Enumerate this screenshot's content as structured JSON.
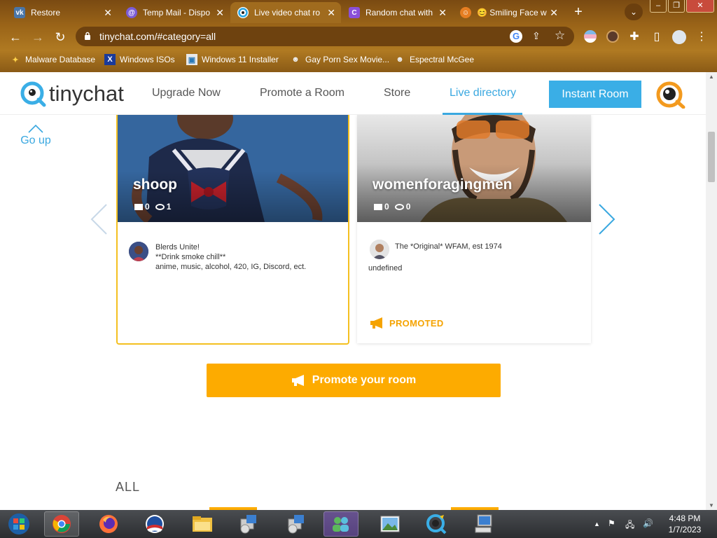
{
  "browser": {
    "tabs": [
      {
        "label": "Restore",
        "icon": "vk-icon",
        "color": "#4a76a8",
        "active": false
      },
      {
        "label": "Temp Mail - Dispo",
        "icon": "temp-mail-icon",
        "color": "#7b5cd6",
        "active": false
      },
      {
        "label": "Live video chat ro",
        "icon": "tinychat-icon",
        "color": "#2aa7e3",
        "active": true
      },
      {
        "label": "Random chat with",
        "icon": "chat-c-icon",
        "color": "#8a4fd8",
        "active": false
      },
      {
        "label": "😊 Smiling Face w",
        "icon": "emoji-icon",
        "color": "#e67e22",
        "active": false
      }
    ],
    "url": "tinychat.com/#category=all",
    "bookmarks": [
      {
        "label": "Malware Database",
        "icon": "mw-icon"
      },
      {
        "label": "Windows ISOs",
        "icon": "x-icon"
      },
      {
        "label": "Windows 11 Installer",
        "icon": "installer-icon"
      },
      {
        "label": "Gay Porn Sex Movie...",
        "icon": "bookmark-icon"
      },
      {
        "label": "Espectral McGee",
        "icon": "bookmark-icon"
      }
    ]
  },
  "site": {
    "logo_text": "tinychat",
    "nav": {
      "upgrade": "Upgrade Now",
      "promote": "Promote a Room",
      "store": "Store",
      "directory": "Live directory"
    },
    "instant_room": "Instant Room",
    "go_up": "Go up"
  },
  "rooms": [
    {
      "name": "shoop",
      "cams": "0",
      "viewers": "1",
      "description": [
        "Blerds Unite!",
        "**Drink smoke chill**",
        "anime, music, alcohol, 420, IG, Discord, ect."
      ]
    },
    {
      "name": "womenforagingmen",
      "cams": "0",
      "viewers": "0",
      "description": [
        "The *Original* WFAM, est 1974"
      ],
      "extra": "undefined",
      "badge": "PROMOTED"
    }
  ],
  "promote_button": "Promote your room",
  "section_label": "ALL",
  "taskbar": {
    "time": "4:48 PM",
    "date": "1/7/2023"
  },
  "colors": {
    "accent_blue": "#3aaee6",
    "promote_orange": "#fdab00",
    "highlight_yellow": "#f4c020"
  }
}
